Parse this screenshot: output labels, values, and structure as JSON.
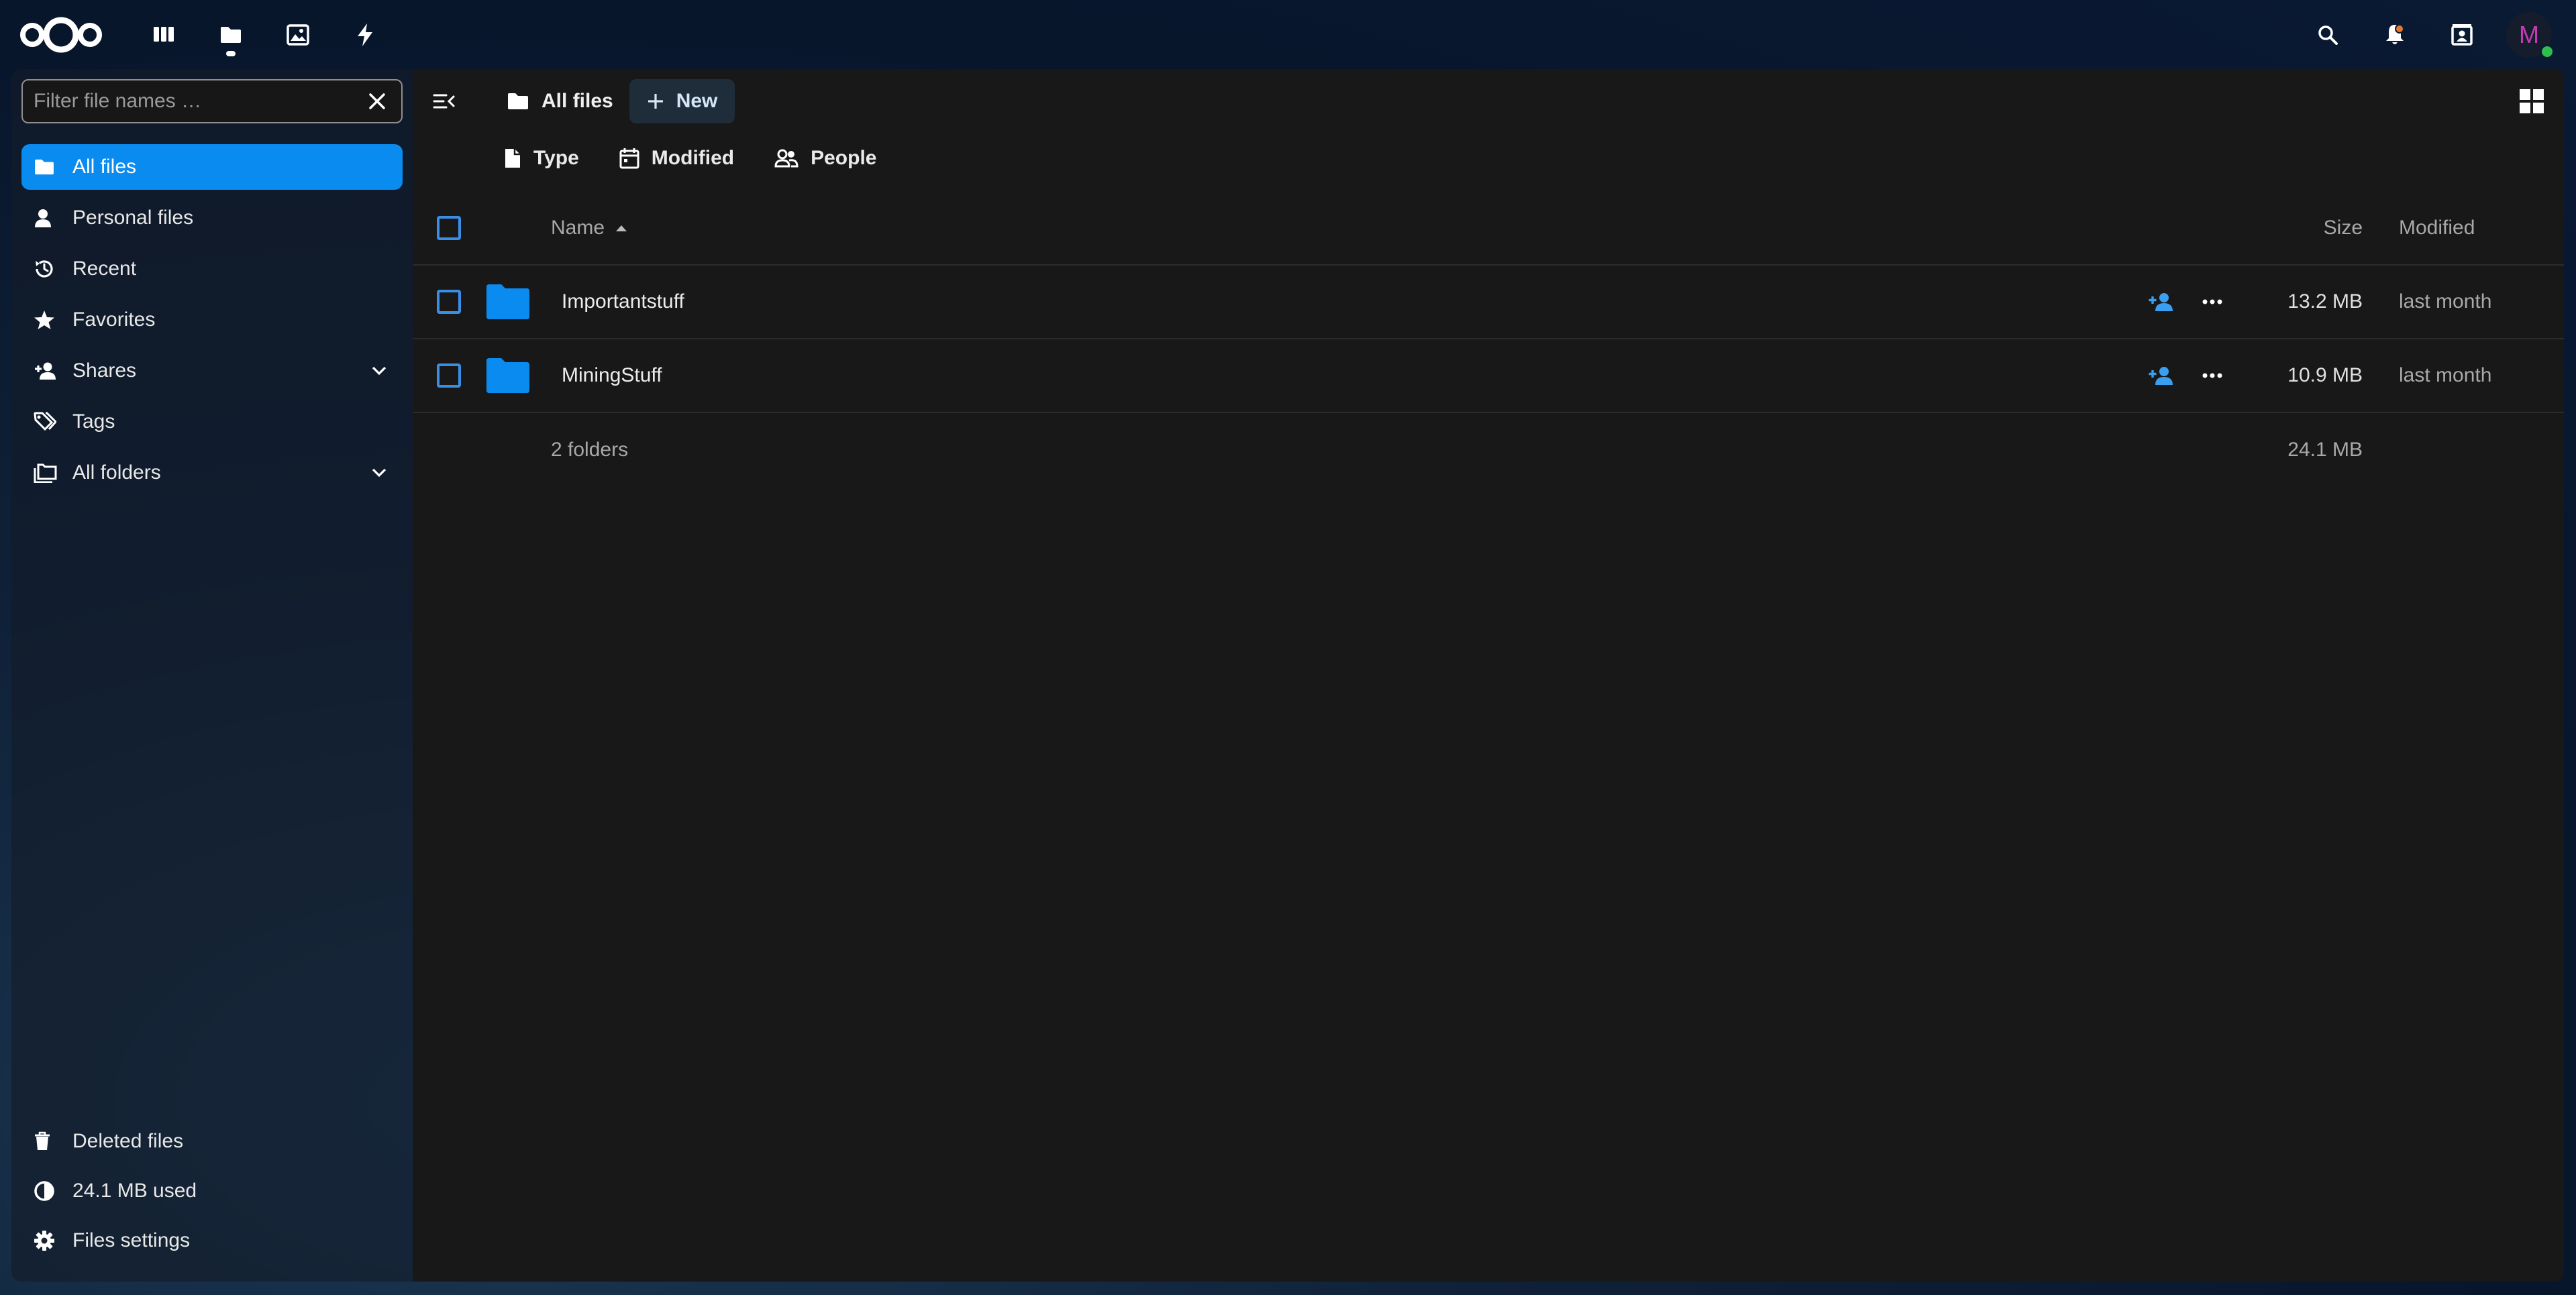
{
  "header": {
    "apps": [
      {
        "name": "Dashboard",
        "icon": "dashboard-icon",
        "active": false
      },
      {
        "name": "Files",
        "icon": "folder-icon",
        "active": true
      },
      {
        "name": "Photos",
        "icon": "image-icon",
        "active": false
      },
      {
        "name": "Activity",
        "icon": "lightning-icon",
        "active": false
      }
    ],
    "avatar_initial": "M"
  },
  "sidebar": {
    "filter_placeholder": "Filter file names …",
    "items": [
      {
        "label": "All files",
        "icon": "folder-icon",
        "active": true
      },
      {
        "label": "Personal files",
        "icon": "person-icon"
      },
      {
        "label": "Recent",
        "icon": "history-icon"
      },
      {
        "label": "Favorites",
        "icon": "star-icon"
      },
      {
        "label": "Shares",
        "icon": "share-icon",
        "expandable": true
      },
      {
        "label": "Tags",
        "icon": "tag-icon"
      },
      {
        "label": "All folders",
        "icon": "folders-icon",
        "expandable": true
      }
    ],
    "bottom": [
      {
        "label": "Deleted files",
        "icon": "trash-icon"
      },
      {
        "label": "24.1 MB used",
        "icon": "pie-chart-icon"
      },
      {
        "label": "Files settings",
        "icon": "gear-icon"
      }
    ]
  },
  "toolbar": {
    "breadcrumb": "All files",
    "new_label": "New"
  },
  "filters": [
    {
      "label": "Type",
      "icon": "file-icon"
    },
    {
      "label": "Modified",
      "icon": "calendar-icon"
    },
    {
      "label": "People",
      "icon": "people-icon"
    }
  ],
  "table": {
    "headers": {
      "name": "Name",
      "size": "Size",
      "modified": "Modified"
    },
    "rows": [
      {
        "name": "Importantstuff",
        "size": "13.2 MB",
        "modified": "last month"
      },
      {
        "name": "MiningStuff",
        "size": "10.9 MB",
        "modified": "last month"
      }
    ],
    "summary": {
      "count": "2 folders",
      "size": "24.1 MB"
    }
  },
  "colors": {
    "accent": "#0a8bef",
    "folder": "#0a8bef",
    "background": "#181818"
  }
}
